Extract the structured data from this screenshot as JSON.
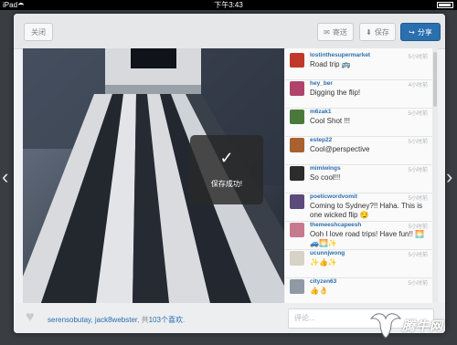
{
  "status_bar": {
    "device": "iPad",
    "time": "下午3:43"
  },
  "toolbar": {
    "close_label": "关闭",
    "send_label": "寄送",
    "save_label": "保存",
    "share_label": "分享"
  },
  "photo": {
    "toast_text": "保存成功!",
    "toast_icon": "check-icon"
  },
  "comments": [
    {
      "user": "lostinthesupermarket",
      "text": "Road trip 🚌",
      "time": "5小时前",
      "avatar_color": "#c0392b"
    },
    {
      "user": "hey_ber",
      "text": "Digging the flip!",
      "time": "4小时前",
      "avatar_color": "#b0436b"
    },
    {
      "user": "m6zak1",
      "text": "Cool Shot !!!",
      "time": "5小时前",
      "avatar_color": "#4a7a3a"
    },
    {
      "user": "estep22",
      "text": "Cool@perspective",
      "time": "5小时前",
      "avatar_color": "#a8612f"
    },
    {
      "user": "mimiwings",
      "text": "So cool!!!",
      "time": "5小时前",
      "avatar_color": "#2c2c2c"
    },
    {
      "user": "poeticwordvomit",
      "text": "Coming to Sydney?!! Haha. This is one wicked flip 😏",
      "time": "5小时前",
      "avatar_color": "#5b4a7a"
    },
    {
      "user": "themeeshcapeesh",
      "text": "Ooh I love road trips! Have fun!! 🌅🚙🌅✨",
      "time": "5小时前",
      "avatar_color": "#c77a8e"
    },
    {
      "user": "ucunnjwong",
      "text": "✨👍✨",
      "time": "5小时前",
      "avatar_color": "#d7d2c6"
    },
    {
      "user": "cityzen63",
      "text": "👍👌",
      "time": "5小时前",
      "avatar_color": "#8f9aa6"
    }
  ],
  "likes": {
    "users": "serensobutay, jack8webster",
    "rest": ", 共",
    "count_text": "103个喜欢",
    "end": "."
  },
  "comment_input": {
    "placeholder": "评论..."
  },
  "watermark": {
    "text": "腾牛网"
  },
  "colors": {
    "accent": "#2a6fae",
    "modal_bg": "#f0f1f3"
  }
}
